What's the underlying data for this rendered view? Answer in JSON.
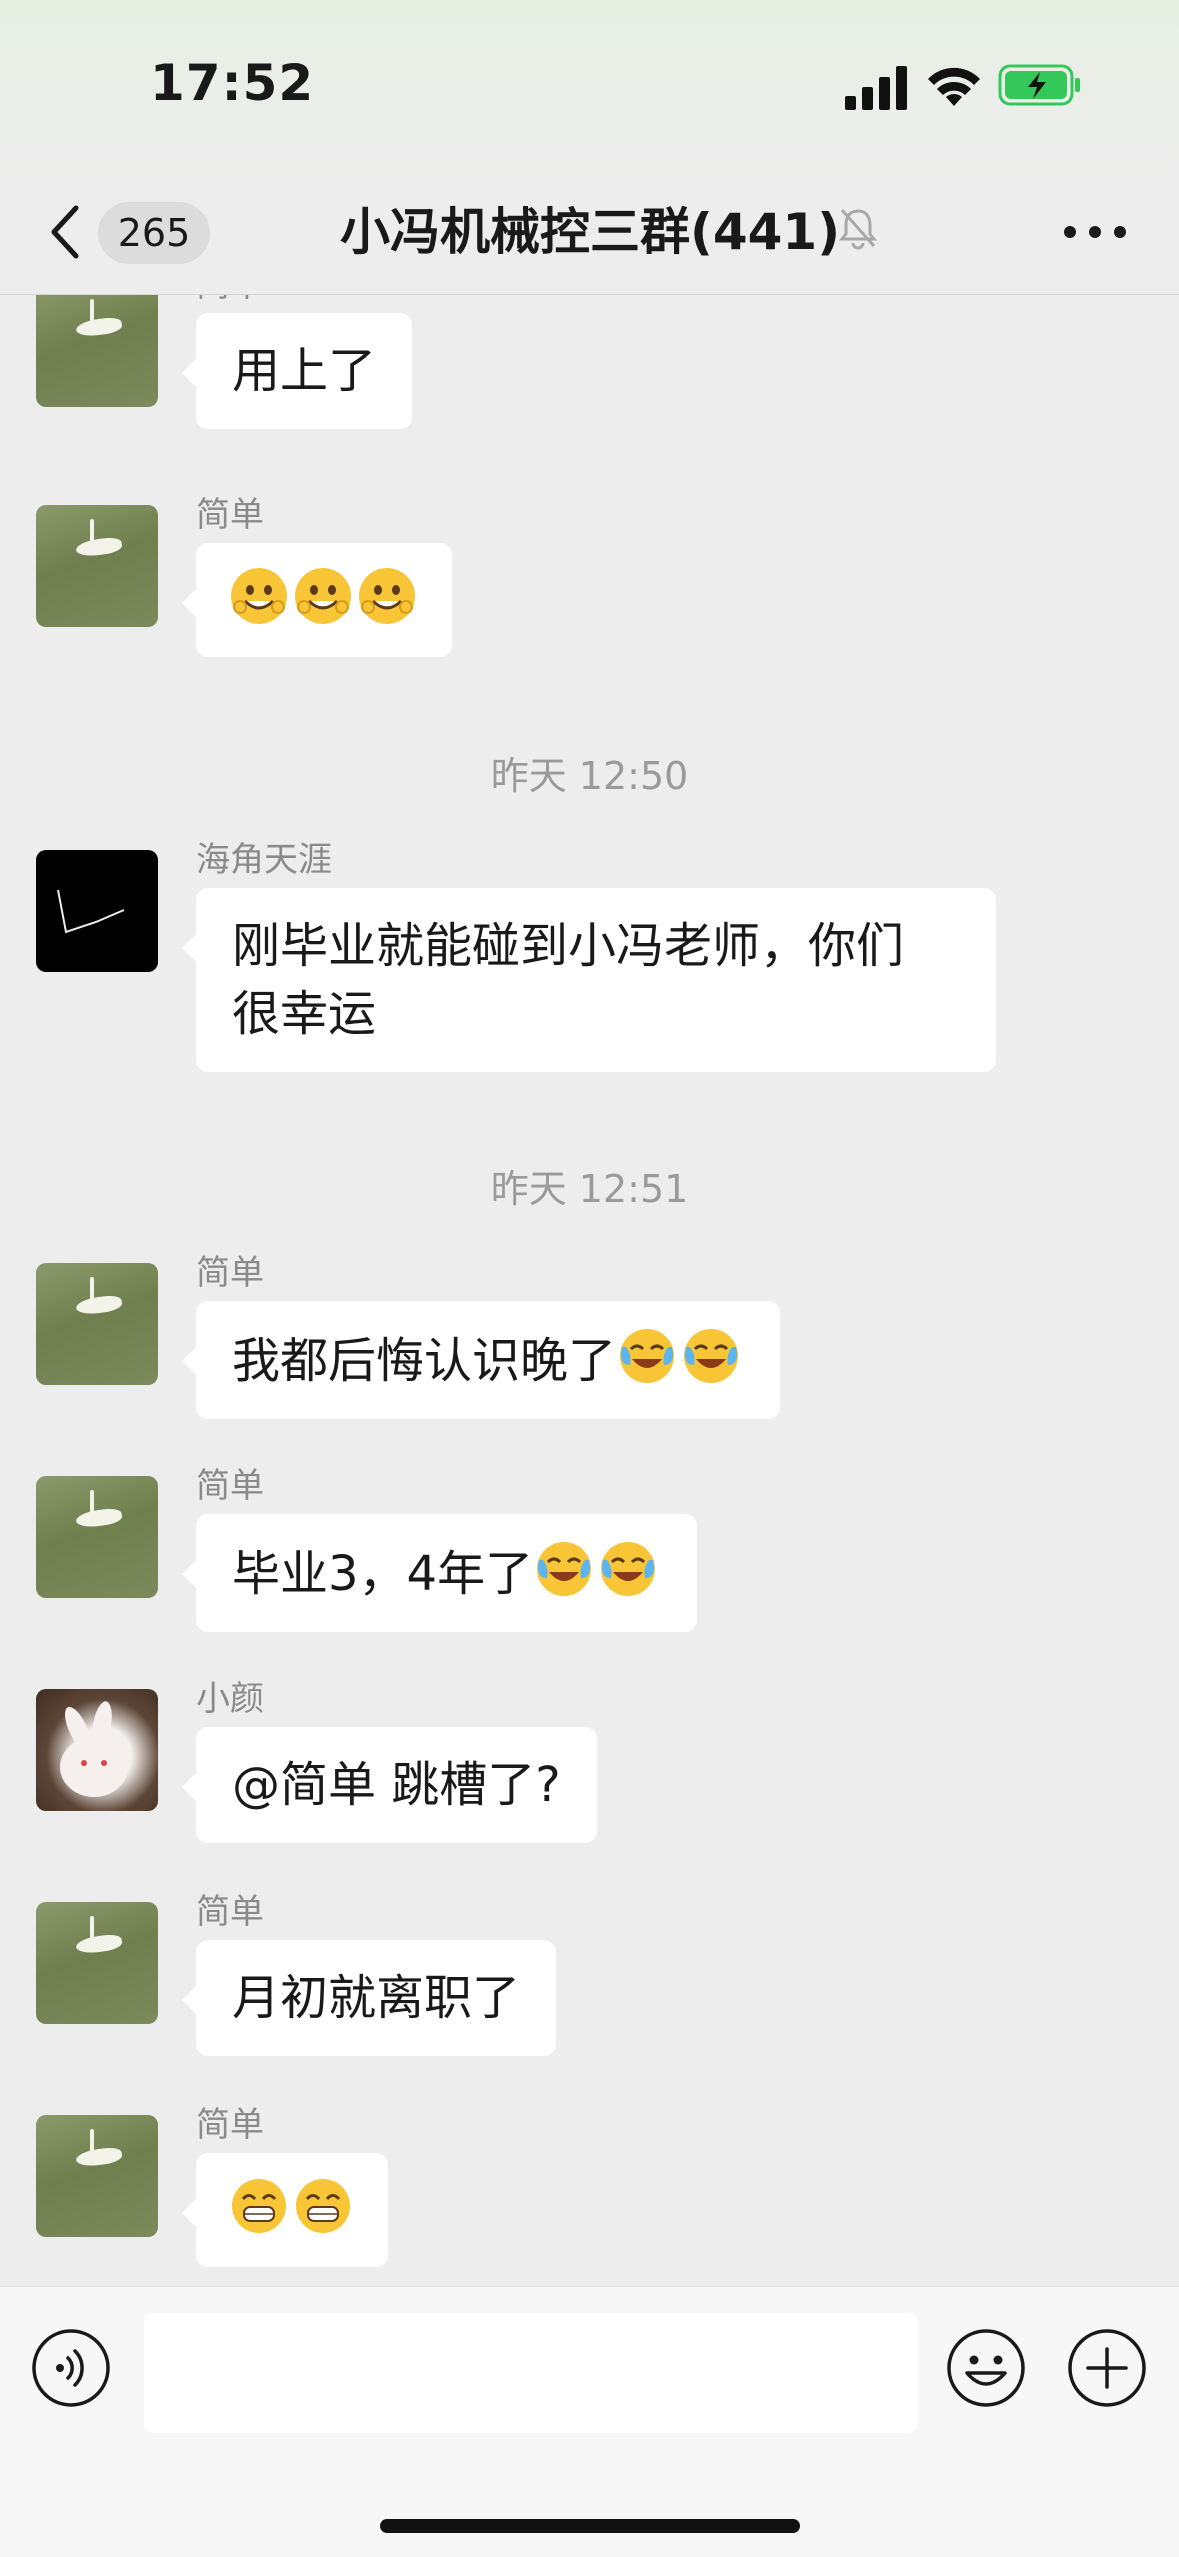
{
  "status_bar": {
    "time": "17:52",
    "battery_state": "charging",
    "accent": "#34c759"
  },
  "nav": {
    "unread_count": "265",
    "title": "小冯机械控三群(441)",
    "muted": true
  },
  "colors": {
    "background": "#ededed",
    "bubble": "#ffffff",
    "meta_text": "#9a9a9a",
    "sender_text": "#8a8a8a"
  },
  "messages": [
    {
      "sender": "简单",
      "text": "用上了",
      "avatar": "white-bird-photo"
    },
    {
      "sender": "简单",
      "text": "",
      "emojis": [
        "smile-emoji",
        "smile-emoji",
        "smile-emoji"
      ],
      "avatar": "white-bird-photo"
    },
    {
      "divider": "昨天 12:50"
    },
    {
      "sender": "海角天涯",
      "text_line1": "刚毕业就能碰到小冯老师，你们",
      "text_line2": "很幸运",
      "avatar": "black-sketch"
    },
    {
      "divider": "昨天 12:51"
    },
    {
      "sender": "简单",
      "text": "我都后悔认识晚了",
      "emojis": [
        "laugh-cry-emoji",
        "laugh-cry-emoji"
      ],
      "avatar": "white-bird-photo"
    },
    {
      "sender": "简单",
      "text": "毕业3，4年了",
      "emojis": [
        "laugh-cry-emoji",
        "laugh-cry-emoji"
      ],
      "avatar": "white-bird-photo"
    },
    {
      "sender": "小颜",
      "text": "@简单 跳槽了?",
      "avatar": "rabbit-photo"
    },
    {
      "sender": "简单",
      "text": "月初就离职了",
      "avatar": "white-bird-photo"
    },
    {
      "sender": "简单",
      "text": "",
      "emojis": [
        "grin-emoji",
        "grin-emoji"
      ],
      "avatar": "white-bird-photo"
    }
  ],
  "input_bar": {
    "placeholder": "",
    "icons": [
      "voice-icon",
      "emoji-icon",
      "plus-icon"
    ]
  }
}
